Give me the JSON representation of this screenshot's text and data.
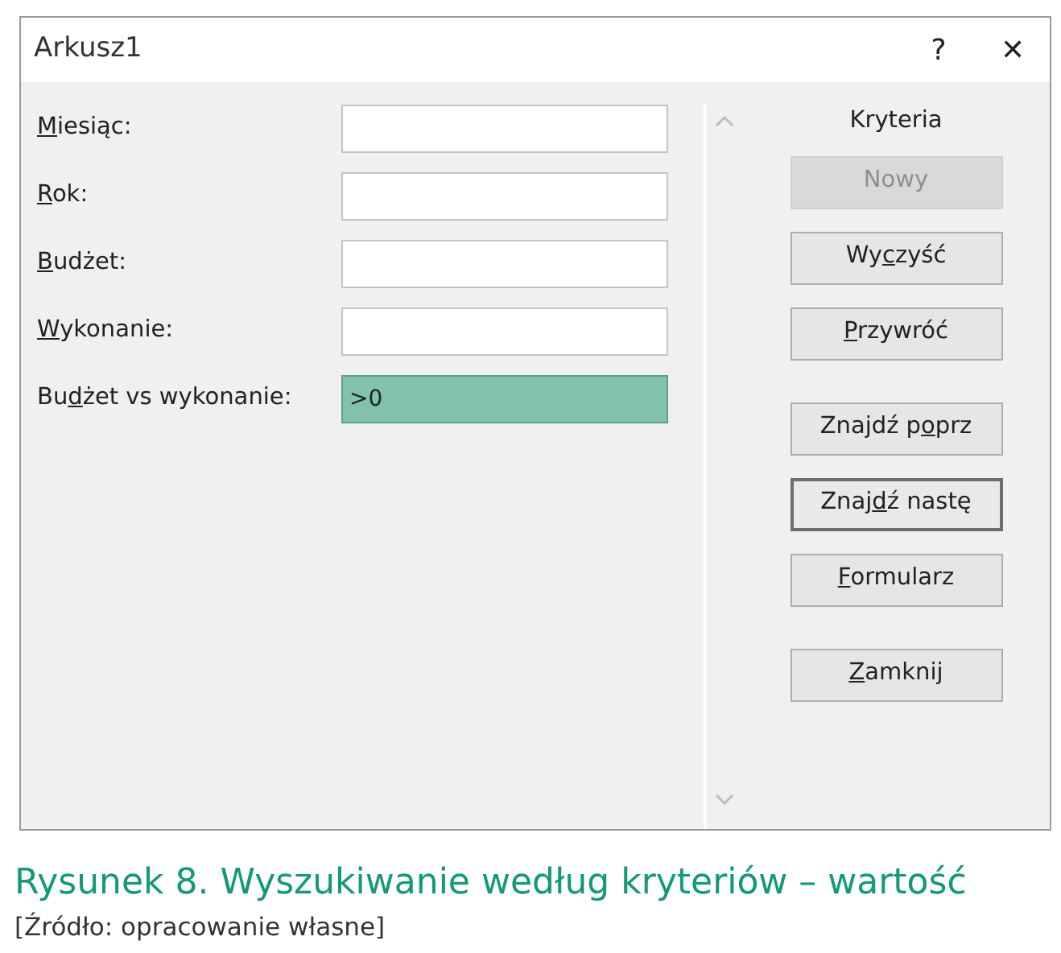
{
  "window": {
    "title": "Arkusz1",
    "help": "?",
    "close": "✕"
  },
  "fields": [
    {
      "label": {
        "key": "M",
        "post": "iesiąc:"
      },
      "highlighted": false
    },
    {
      "label": {
        "key": "R",
        "post": "ok:"
      },
      "highlighted": false
    },
    {
      "label": {
        "key": "B",
        "post": "udżet:"
      },
      "highlighted": false
    },
    {
      "label": {
        "key": "W",
        "post": "ykonanie:"
      },
      "highlighted": false
    },
    {
      "label": {
        "pre": "Bu",
        "key": "d",
        "post": "żet vs wykonanie:"
      },
      "value": ">0",
      "highlighted": true
    }
  ],
  "panel_title": "Kryteria",
  "button_groups": [
    [
      {
        "label": {
          "pre": "Nowy"
        },
        "disabled": true,
        "default": false
      },
      {
        "label": {
          "pre": "Wy",
          "key": "c",
          "post": "zyść"
        },
        "disabled": false,
        "default": false
      },
      {
        "label": {
          "key": "P",
          "post": "rzywróć"
        },
        "disabled": false,
        "default": false
      }
    ],
    [
      {
        "label": {
          "pre": "Znajdź p",
          "key": "o",
          "post": "prz"
        },
        "disabled": false,
        "default": false
      },
      {
        "label": {
          "pre": "Znaj",
          "key": "d",
          "post": "ź nastę"
        },
        "disabled": false,
        "default": true
      },
      {
        "label": {
          "key": "F",
          "post": "ormularz"
        },
        "disabled": false,
        "default": false
      }
    ],
    [
      {
        "label": {
          "key": "Z",
          "post": "amknij"
        },
        "disabled": false,
        "default": false
      }
    ]
  ],
  "caption": {
    "title": "Rysunek 8. Wyszukiwanie według kryteriów – wartość",
    "source": "[Źródło: opracowanie własne]"
  }
}
